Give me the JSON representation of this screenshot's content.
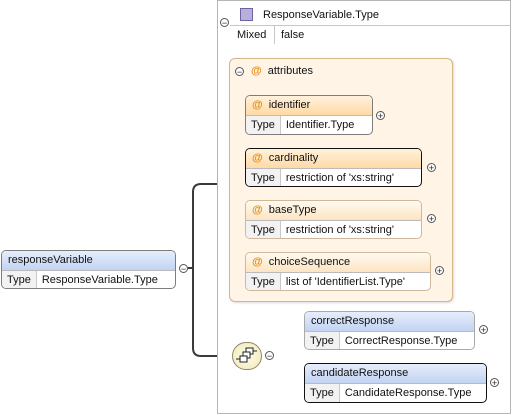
{
  "outer_type": {
    "name": "ResponseVariable.Type",
    "mixed_label": "Mixed",
    "mixed_value": "false"
  },
  "attributes_group": {
    "label": "attributes",
    "items": [
      {
        "name": "identifier",
        "type_label": "Type",
        "type": "Identifier.Type"
      },
      {
        "name": "cardinality",
        "type_label": "Type",
        "type": "restriction of 'xs:string'"
      },
      {
        "name": "baseType",
        "type_label": "Type",
        "type": "restriction of 'xs:string'"
      },
      {
        "name": "choiceSequence",
        "type_label": "Type",
        "type": "list of 'IdentifierList.Type'"
      }
    ]
  },
  "root_element": {
    "name": "responseVariable",
    "type_label": "Type",
    "type": "ResponseVariable.Type"
  },
  "children": [
    {
      "name": "correctResponse",
      "type_label": "Type",
      "type": "CorrectResponse.Type"
    },
    {
      "name": "candidateResponse",
      "type_label": "Type",
      "type": "CandidateResponse.Type"
    }
  ],
  "symbols": {
    "collapse": "−",
    "expand": "+",
    "attribute_marker": "@"
  },
  "colors": {
    "element_header": "#c2d3f2",
    "attribute_header": "#ffd9a6",
    "attributes_bg": "#fff4e6",
    "type_icon": "#b9aedc"
  }
}
